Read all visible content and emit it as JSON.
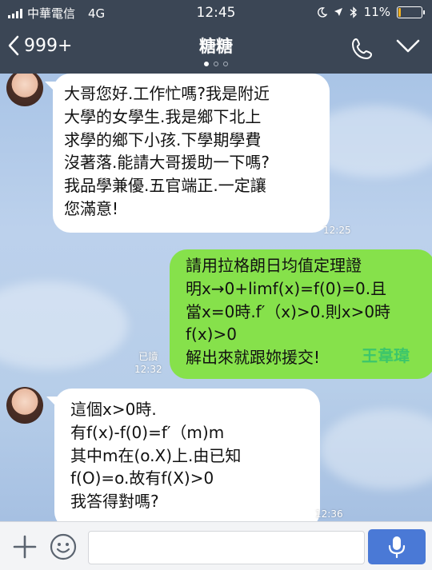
{
  "status_bar": {
    "carrier": "中華電信",
    "network": "4G",
    "time": "12:45",
    "battery": "11%",
    "battery_level": 0.11
  },
  "header": {
    "back_label": "999+",
    "title": "糖糖",
    "page_dots": 3,
    "active_page": 0
  },
  "messages": [
    {
      "direction": "incoming",
      "lines": [
        "大哥您好.工作忙嗎?我是附近",
        "大學的女學生.我是鄉下北上",
        "求學的鄉下小孩.下學期學費",
        "沒著落.能請大哥援助一下嗎?",
        "我品學兼優.五官端正.一定讓",
        "您滿意!"
      ],
      "time": "12:25"
    },
    {
      "direction": "outgoing",
      "lines": [
        "請用拉格朗日均值定理證",
        "明x→0+limf(x)=f(0)=0.且",
        "當x=0時.f′（x)>0.則x>0時",
        "f(x)>0",
        "解出來就跟妳援交!"
      ],
      "read_label": "已讀",
      "time": "12:32"
    },
    {
      "direction": "incoming",
      "lines": [
        "這個x>0時.",
        "有f(x)-f(0)=f′（m)m",
        "其中m在(o.X)上.由已知",
        "f(O)=o.故有f(X)>0",
        "我答得對嗎?"
      ],
      "time": "12:36"
    }
  ],
  "watermark": "王韋瑋",
  "icons": {
    "back": "chevron-left-icon",
    "call": "phone-icon",
    "menu": "chevron-down-icon",
    "add": "plus-icon",
    "sticker": "smiley-icon",
    "voice": "microphone-icon"
  },
  "colors": {
    "header_bg": "#3b4655",
    "outgoing_bubble": "#86e14b",
    "incoming_bubble": "#ffffff",
    "mic_button": "#4a79d6",
    "watermark": "#3cc66b"
  }
}
